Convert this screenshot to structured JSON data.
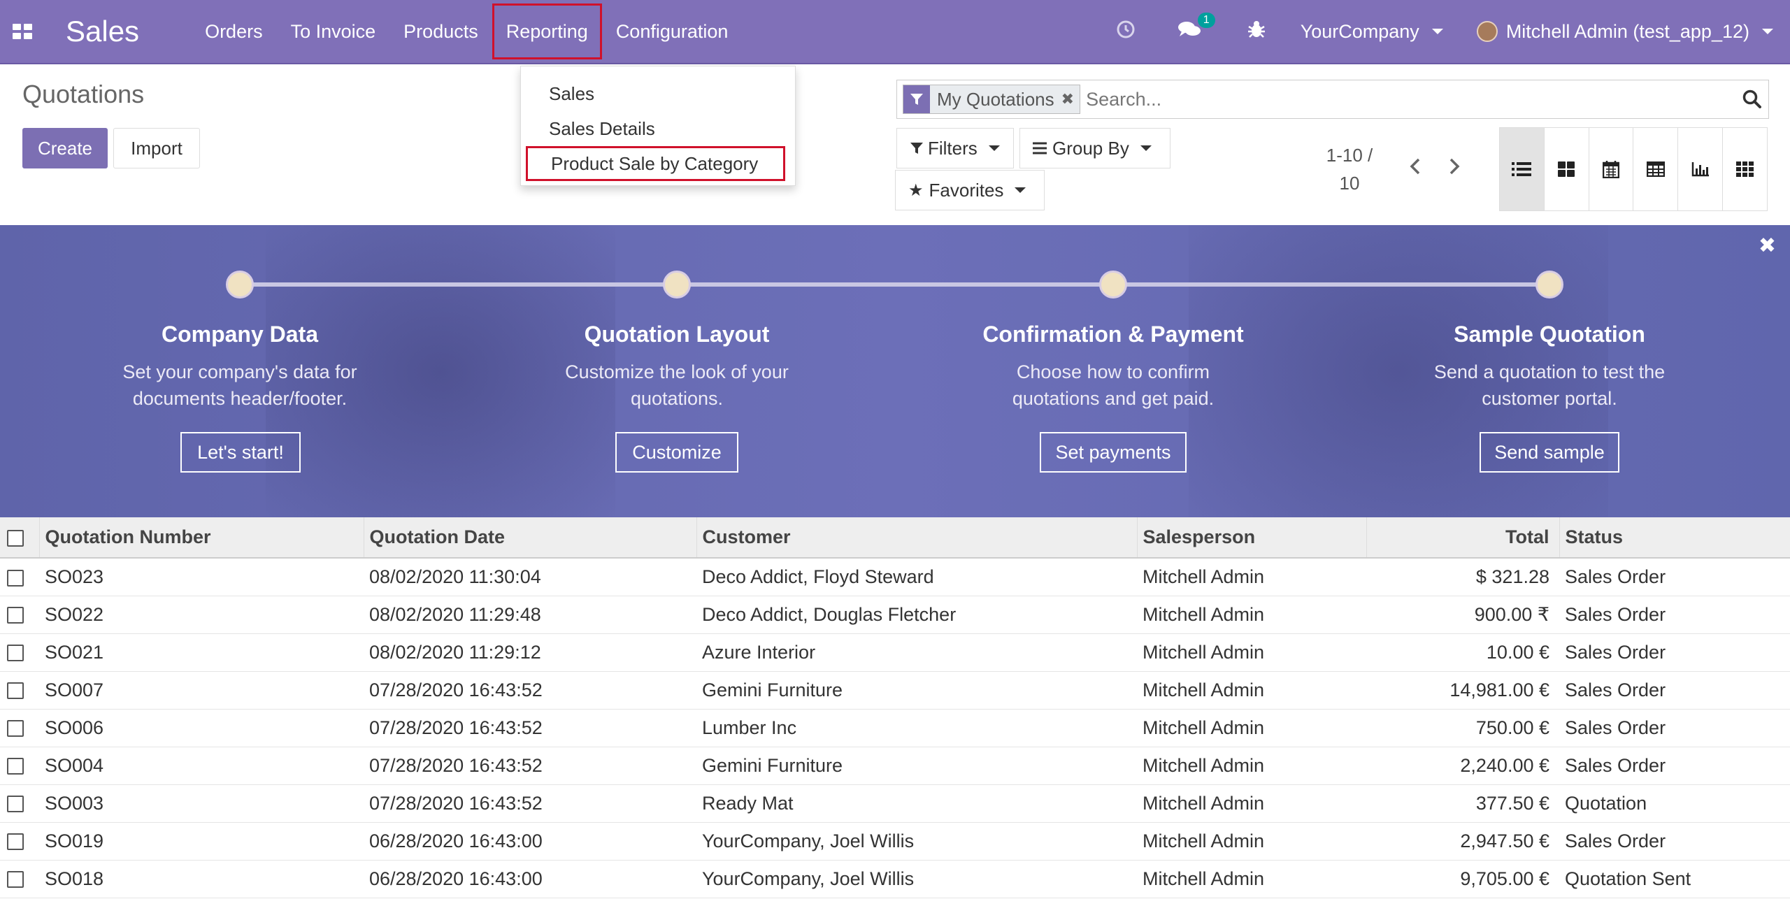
{
  "navbar": {
    "brand": "Sales",
    "menu": [
      "Orders",
      "To Invoice",
      "Products",
      "Reporting",
      "Configuration"
    ],
    "messages_badge": "1",
    "company": "YourCompany",
    "user": "Mitchell Admin (test_app_12)"
  },
  "reporting_menu": {
    "items": [
      "Sales",
      "Sales Details",
      "Product Sale by Category"
    ]
  },
  "control_panel": {
    "title": "Quotations",
    "create_label": "Create",
    "import_label": "Import",
    "search_facet": "My Quotations",
    "search_placeholder": "Search...",
    "filters_label": "Filters",
    "groupby_label": "Group By",
    "favorites_label": "Favorites",
    "pager_line1": "1-10 /",
    "pager_line2": "10"
  },
  "banner": {
    "steps": [
      {
        "title": "Company Data",
        "desc_line1": "Set your company's data for",
        "desc_line2": "documents header/footer.",
        "button": "Let's start!"
      },
      {
        "title": "Quotation Layout",
        "desc_line1": "Customize the look of your",
        "desc_line2": "quotations.",
        "button": "Customize"
      },
      {
        "title": "Confirmation & Payment",
        "desc_line1": "Choose how to confirm",
        "desc_line2": "quotations and get paid.",
        "button": "Set payments"
      },
      {
        "title": "Sample Quotation",
        "desc_line1": "Send a quotation to test the",
        "desc_line2": "customer portal.",
        "button": "Send sample"
      }
    ]
  },
  "table": {
    "headers": [
      "Quotation Number",
      "Quotation Date",
      "Customer",
      "Salesperson",
      "Total",
      "Status"
    ],
    "rows": [
      [
        "SO023",
        "08/02/2020 11:30:04",
        "Deco Addict, Floyd Steward",
        "Mitchell Admin",
        "$ 321.28",
        "Sales Order"
      ],
      [
        "SO022",
        "08/02/2020 11:29:48",
        "Deco Addict, Douglas Fletcher",
        "Mitchell Admin",
        "900.00 ₹",
        "Sales Order"
      ],
      [
        "SO021",
        "08/02/2020 11:29:12",
        "Azure Interior",
        "Mitchell Admin",
        "10.00 €",
        "Sales Order"
      ],
      [
        "SO007",
        "07/28/2020 16:43:52",
        "Gemini Furniture",
        "Mitchell Admin",
        "14,981.00 €",
        "Sales Order"
      ],
      [
        "SO006",
        "07/28/2020 16:43:52",
        "Lumber Inc",
        "Mitchell Admin",
        "750.00 €",
        "Sales Order"
      ],
      [
        "SO004",
        "07/28/2020 16:43:52",
        "Gemini Furniture",
        "Mitchell Admin",
        "2,240.00 €",
        "Sales Order"
      ],
      [
        "SO003",
        "07/28/2020 16:43:52",
        "Ready Mat",
        "Mitchell Admin",
        "377.50 €",
        "Quotation"
      ],
      [
        "SO019",
        "06/28/2020 16:43:00",
        "YourCompany, Joel Willis",
        "Mitchell Admin",
        "2,947.50 €",
        "Sales Order"
      ],
      [
        "SO018",
        "06/28/2020 16:43:00",
        "YourCompany, Joel Willis",
        "Mitchell Admin",
        "9,705.00 €",
        "Quotation Sent"
      ]
    ]
  },
  "colors": {
    "navbar": "#8070b8",
    "primary": "#7c6fb3",
    "highlight_border": "#d0112b",
    "badge": "#00a09d"
  },
  "icons": [
    "apps-grid-icon",
    "clock-icon",
    "chat-icon",
    "bug-icon",
    "filter-icon",
    "close-icon",
    "search-icon",
    "star-icon",
    "list-view-icon",
    "kanban-view-icon",
    "calendar-view-icon",
    "pivot-view-icon",
    "graph-view-icon",
    "activity-view-icon",
    "chevron-left-icon",
    "chevron-right-icon"
  ]
}
